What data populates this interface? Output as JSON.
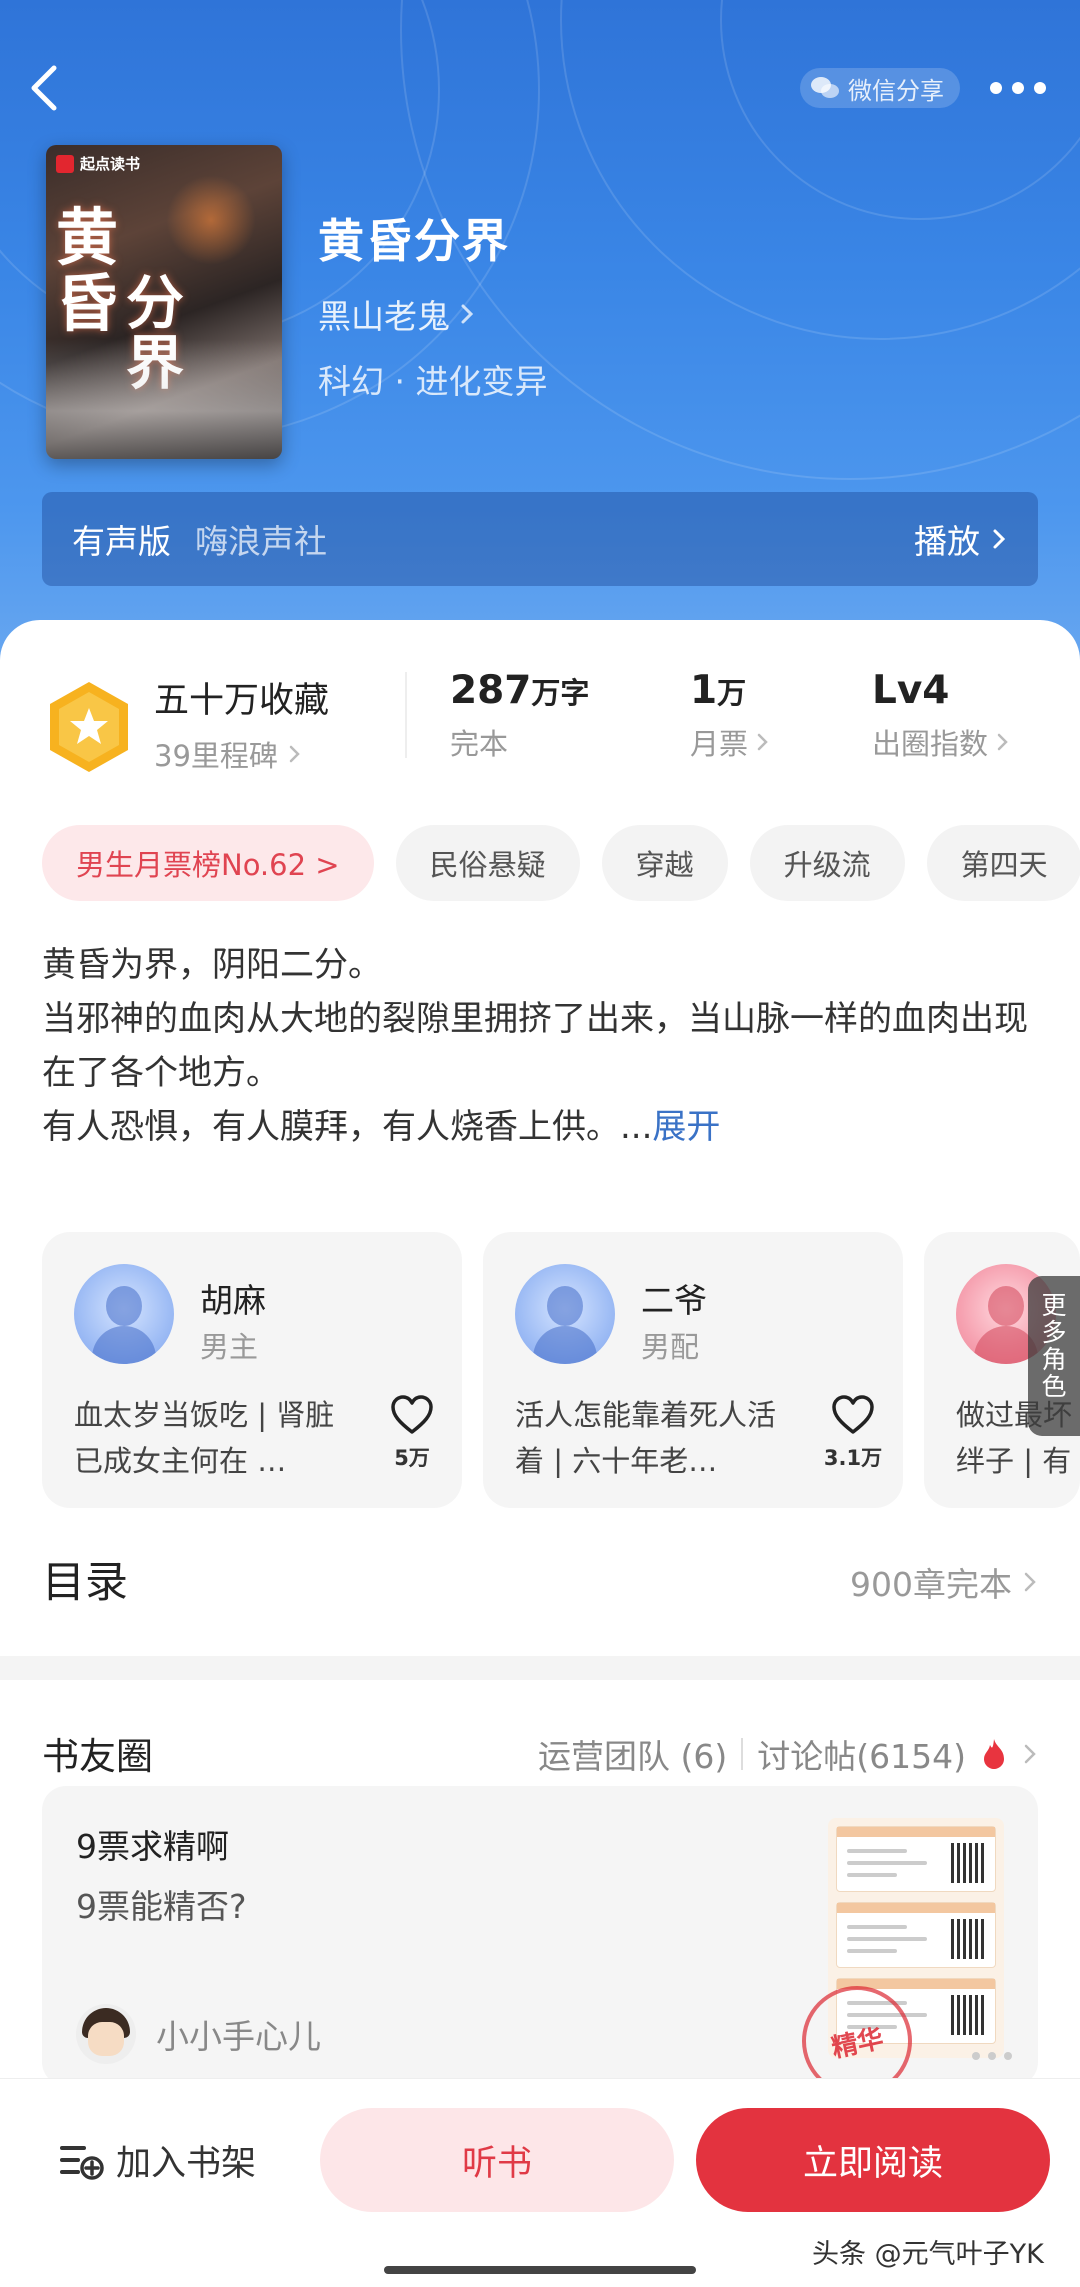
{
  "header": {
    "share_label": "微信分享"
  },
  "book": {
    "cover_publisher": "起点读书",
    "cover_title_a": "黄昏",
    "cover_title_b": "分界",
    "title": "黄昏分界",
    "author": "黑山老鬼",
    "genre": "科幻 · 进化变异"
  },
  "audio": {
    "label": "有声版",
    "publisher": "嗨浪声社",
    "play_label": "播放"
  },
  "stats": {
    "collect_title": "五十万收藏",
    "collect_sub": "39里程碑",
    "words_value": "287",
    "words_unit": "万字",
    "words_label": "完本",
    "tickets_value": "1",
    "tickets_unit": "万",
    "tickets_label": "月票",
    "level_value": "Lv4",
    "level_label": "出圈指数"
  },
  "tags": [
    "男生月票榜No.62 >",
    "民俗悬疑",
    "穿越",
    "升级流",
    "第四天"
  ],
  "synopsis": {
    "line1": "黄昏为界，阴阳二分。",
    "line2": "当邪神的血肉从大地的裂隙里拥挤了出来，当山脉一样的血肉出现在了各个地方。",
    "line3": "有人恐惧，有人膜拜，有人烧香上供。...",
    "expand": "展开"
  },
  "roles": [
    {
      "name": "胡麻",
      "kind": "男主",
      "desc": "血太岁当饭吃 | 肾脏已成女主何在 …",
      "likes": "5万"
    },
    {
      "name": "二爷",
      "kind": "男配",
      "desc": "活人怎能靠着死人活着 | 六十年老…",
      "likes": "3.1万"
    },
    {
      "name": "",
      "kind": "",
      "desc": "做过最坏 绊子 | 有",
      "likes": ""
    }
  ],
  "more_roles": "更多角色",
  "toc": {
    "title": "目录",
    "summary": "900章完本"
  },
  "circle": {
    "title": "书友圈",
    "team": "运营团队 (6)",
    "posts": "讨论帖(6154)"
  },
  "post": {
    "title": "9票求精啊",
    "body": "9票能精否?",
    "user": "小小手心儿",
    "stamp": "精华"
  },
  "bottom": {
    "shelf": "加入书架",
    "listen": "听书",
    "read": "立即阅读"
  },
  "watermark": "头条 @元气叶子YK",
  "colors": {
    "accent": "#e3333f",
    "hero": "#3a86e6",
    "link": "#3a72c6"
  }
}
